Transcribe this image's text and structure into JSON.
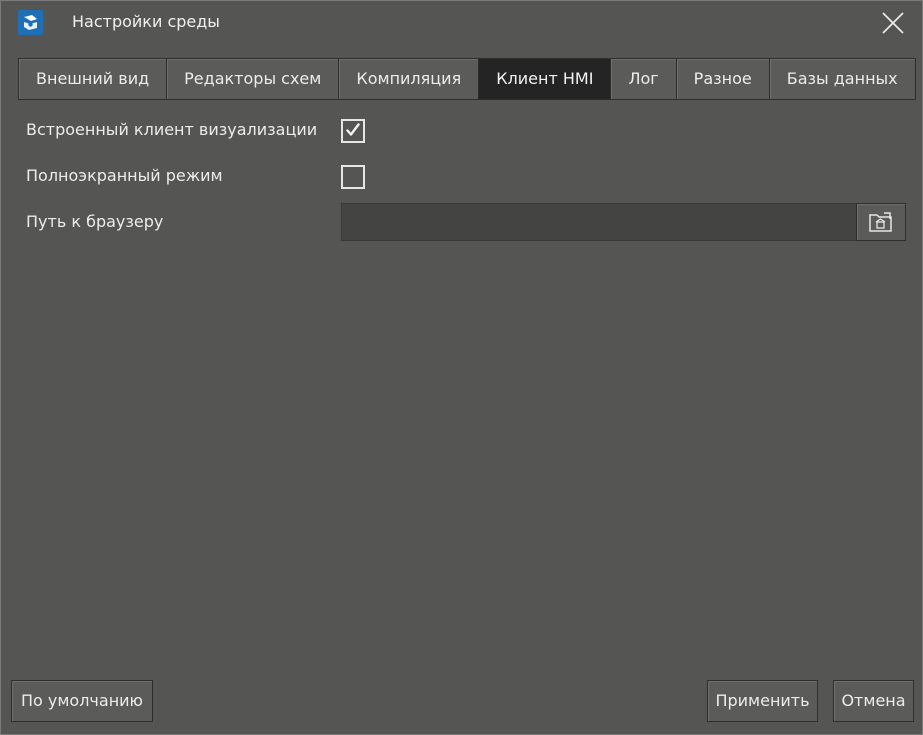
{
  "window": {
    "title": "Настройки среды"
  },
  "tabs": [
    {
      "label": "Внешний вид",
      "active": false
    },
    {
      "label": "Редакторы схем",
      "active": false
    },
    {
      "label": "Компиляция",
      "active": false
    },
    {
      "label": "Клиент HMI",
      "active": true
    },
    {
      "label": "Лог",
      "active": false
    },
    {
      "label": "Разное",
      "active": false
    },
    {
      "label": "Базы данных",
      "active": false
    }
  ],
  "settings": {
    "embedded_client": {
      "label": "Встроенный клиент визуализации",
      "checked": true
    },
    "fullscreen": {
      "label": "Полноэкранный режим",
      "checked": false
    },
    "browser_path": {
      "label": "Путь к браузеру",
      "value": ""
    }
  },
  "footer": {
    "defaults_label": "По умолчанию",
    "apply_label": "Применить",
    "cancel_label": "Отмена"
  },
  "icons": {
    "app": "app-logo-icon",
    "close": "close-icon",
    "check": "checkmark-icon",
    "browse": "folder-browse-icon"
  },
  "colors": {
    "background": "#555553",
    "active_tab": "#242424",
    "app_icon": "#1e6fb5"
  }
}
